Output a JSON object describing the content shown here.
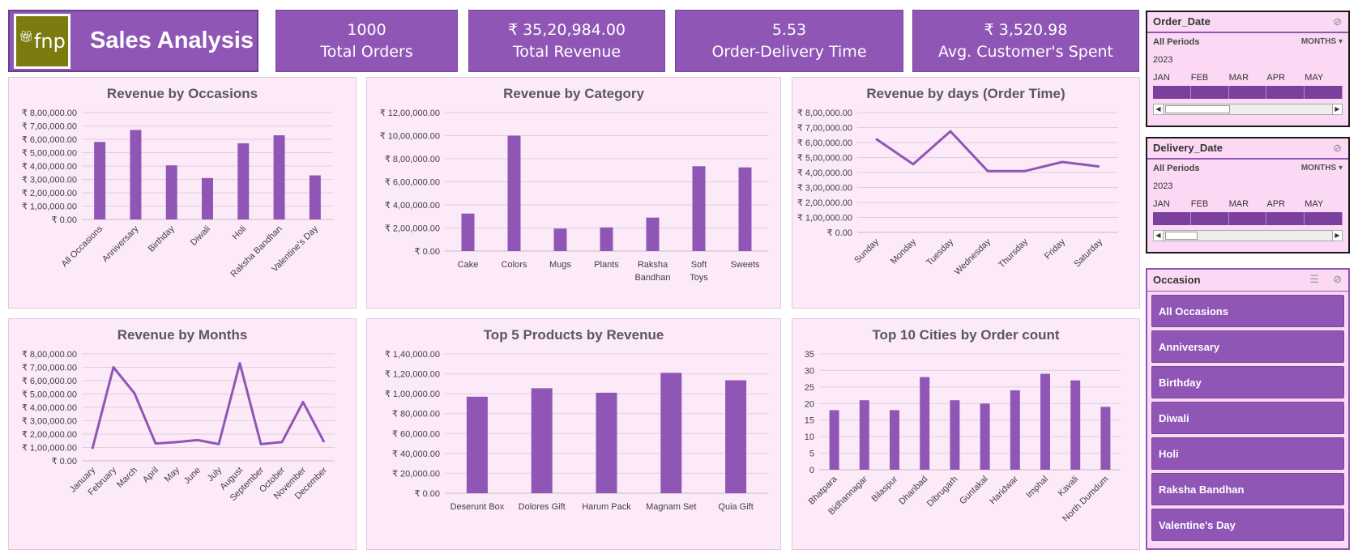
{
  "header": {
    "title": "Sales Analysis",
    "logo_text": "fnp"
  },
  "kpis": [
    {
      "value": "1000",
      "label": "Total Orders"
    },
    {
      "value": "₹ 35,20,984.00",
      "label": "Total Revenue"
    },
    {
      "value": "5.53",
      "label": "Order-Delivery Time"
    },
    {
      "value": "₹ 3,520.98",
      "label": "Avg. Customer's Spent"
    }
  ],
  "colors": {
    "accent": "#9056b6",
    "panel_bg": "#fdeaf9",
    "slicer_bg": "#fbd9f4",
    "line": "#9056b6"
  },
  "chart_data": [
    {
      "type": "bar",
      "title": "Revenue by Occasions",
      "categories": [
        "All Occasions",
        "Anniversary",
        "Birthday",
        "Diwali",
        "Holi",
        "Raksha Bandhan",
        "Valentine's Day"
      ],
      "values": [
        580000,
        670000,
        405000,
        310000,
        570000,
        630000,
        330000
      ],
      "ylim": [
        0,
        800000
      ],
      "yticks": [
        "₹ 0.00",
        "₹ 1,00,000.00",
        "₹ 2,00,000.00",
        "₹ 3,00,000.00",
        "₹ 4,00,000.00",
        "₹ 5,00,000.00",
        "₹ 6,00,000.00",
        "₹ 7,00,000.00",
        "₹ 8,00,000.00"
      ],
      "grid": true
    },
    {
      "type": "bar",
      "title": "Revenue by Category",
      "categories": [
        "Cake",
        "Colors",
        "Mugs",
        "Plants",
        "Raksha Bandhan",
        "Soft Toys",
        "Sweets"
      ],
      "values": [
        325000,
        1000000,
        195000,
        205000,
        290000,
        735000,
        725000
      ],
      "ylim": [
        0,
        1200000
      ],
      "yticks": [
        "₹ 0.00",
        "₹ 2,00,000.00",
        "₹ 4,00,000.00",
        "₹ 6,00,000.00",
        "₹ 8,00,000.00",
        "₹ 10,00,000.00",
        "₹ 12,00,000.00"
      ],
      "grid": true
    },
    {
      "type": "line",
      "title": "Revenue by days (Order Time)",
      "categories": [
        "Sunday",
        "Monday",
        "Tuesday",
        "Wednesday",
        "Thursday",
        "Friday",
        "Saturday"
      ],
      "values": [
        625000,
        455000,
        675000,
        410000,
        410000,
        470000,
        440000
      ],
      "ylim": [
        0,
        800000
      ],
      "yticks": [
        "₹ 0.00",
        "₹ 1,00,000.00",
        "₹ 2,00,000.00",
        "₹ 3,00,000.00",
        "₹ 4,00,000.00",
        "₹ 5,00,000.00",
        "₹ 6,00,000.00",
        "₹ 7,00,000.00",
        "₹ 8,00,000.00"
      ],
      "grid": true
    },
    {
      "type": "line",
      "title": "Revenue by Months",
      "categories": [
        "January",
        "February",
        "March",
        "April",
        "May",
        "June",
        "July",
        "August",
        "September",
        "October",
        "November",
        "December"
      ],
      "values": [
        90000,
        700000,
        505000,
        130000,
        140000,
        155000,
        125000,
        730000,
        125000,
        140000,
        440000,
        140000
      ],
      "ylim": [
        0,
        800000
      ],
      "yticks": [
        "₹ 0.00",
        "₹ 1,00,000.00",
        "₹ 2,00,000.00",
        "₹ 3,00,000.00",
        "₹ 4,00,000.00",
        "₹ 5,00,000.00",
        "₹ 6,00,000.00",
        "₹ 7,00,000.00",
        "₹ 8,00,000.00"
      ],
      "grid": true
    },
    {
      "type": "bar",
      "title": "Top 5 Products by Revenue",
      "categories": [
        "Deserunt Box",
        "Dolores Gift",
        "Harum Pack",
        "Magnam Set",
        "Quia Gift"
      ],
      "values": [
        97000,
        105500,
        101000,
        121000,
        113500
      ],
      "ylim": [
        0,
        140000
      ],
      "yticks": [
        "₹ 0.00",
        "₹ 20,000.00",
        "₹ 40,000.00",
        "₹ 60,000.00",
        "₹ 80,000.00",
        "₹ 1,00,000.00",
        "₹ 1,20,000.00",
        "₹ 1,40,000.00"
      ],
      "grid": true
    },
    {
      "type": "bar",
      "title": "Top 10 Cities by Order count",
      "categories": [
        "Bhatpara",
        "Bidhannagar",
        "Bilaspur",
        "Dhanbad",
        "Dibrugarh",
        "Guntakal",
        "Haridwar",
        "Imphal",
        "Kavali",
        "North Dumdum"
      ],
      "values": [
        18,
        21,
        18,
        28,
        21,
        20,
        24,
        29,
        27,
        19
      ],
      "ylim": [
        0,
        35
      ],
      "yticks": [
        "0",
        "5",
        "10",
        "15",
        "20",
        "25",
        "30",
        "35"
      ],
      "grid": true
    }
  ],
  "slicers": {
    "order_date": {
      "title": "Order_Date",
      "period": "All Periods",
      "level": "MONTHS",
      "year": "2023",
      "months": [
        "JAN",
        "FEB",
        "MAR",
        "APR",
        "MAY"
      ]
    },
    "delivery_date": {
      "title": "Delivery_Date",
      "period": "All Periods",
      "level": "MONTHS",
      "year": "2023",
      "months": [
        "JAN",
        "FEB",
        "MAR",
        "APR",
        "MAY"
      ]
    },
    "occasion": {
      "title": "Occasion",
      "items": [
        "All Occasions",
        "Anniversary",
        "Birthday",
        "Diwali",
        "Holi",
        "Raksha Bandhan",
        "Valentine's Day"
      ]
    }
  }
}
